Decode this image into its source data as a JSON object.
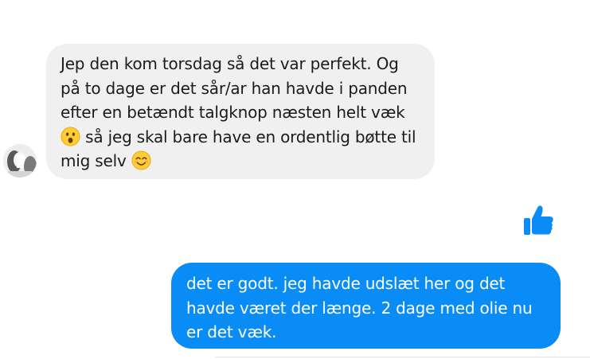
{
  "conversation": {
    "incoming": {
      "lines": [
        "Jep den kom torsdag så det var perfekt. Og",
        "på to dage er det sår/ar han havde i panden",
        "efter en betændt talgknop næsten helt væk",
        "så jeg skal bare have en ordentlig bøtte til",
        "mig selv"
      ],
      "emojis": [
        "surprised-face-emoji",
        "smiling-face-emoji"
      ]
    },
    "reaction": {
      "icon": "thumbs-up-icon",
      "color": "#0a8cf7"
    },
    "outgoing": {
      "lines": [
        "det er godt. jeg havde udslæt her og det",
        "havde været der længe. 2 dage med olie nu",
        "er det væk."
      ]
    }
  },
  "colors": {
    "incoming_bubble": "#f0f0f0",
    "outgoing_bubble": "#0a8cf7",
    "incoming_text": "#1b1b1b",
    "outgoing_text": "#ffffff"
  }
}
